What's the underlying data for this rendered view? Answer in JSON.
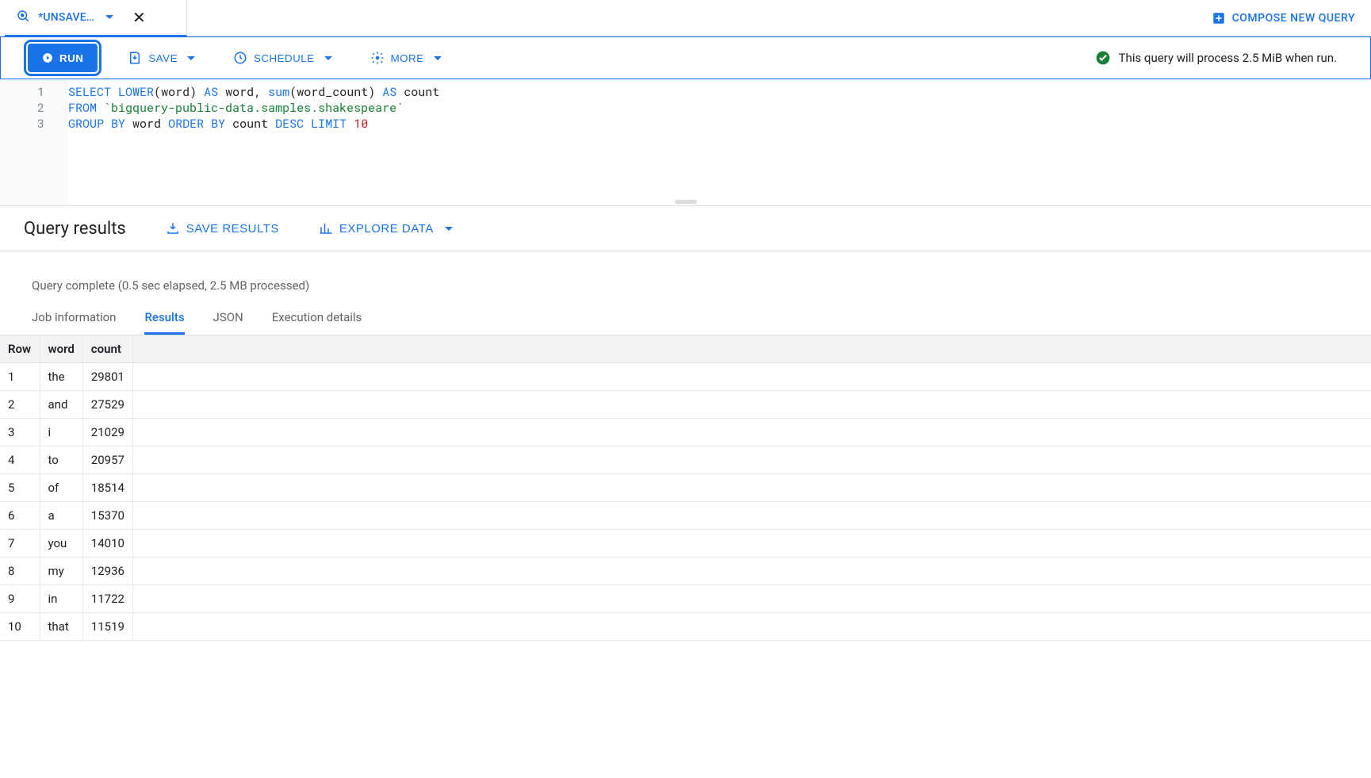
{
  "tab": {
    "title": "*UNSAVE…"
  },
  "compose": {
    "label": "COMPOSE NEW QUERY"
  },
  "toolbar": {
    "run": "RUN",
    "save": "SAVE",
    "schedule": "SCHEDULE",
    "more": "MORE",
    "status": "This query will process 2.5 MiB when run."
  },
  "editor": {
    "lines": [
      {
        "num": "1",
        "tokens": [
          {
            "t": "SELECT",
            "c": "kw"
          },
          {
            "t": " ",
            "c": "punc"
          },
          {
            "t": "LOWER",
            "c": "fn"
          },
          {
            "t": "(",
            "c": "punc"
          },
          {
            "t": "word",
            "c": "ident"
          },
          {
            "t": ")",
            "c": "punc"
          },
          {
            "t": " ",
            "c": "punc"
          },
          {
            "t": "AS",
            "c": "kw"
          },
          {
            "t": " ",
            "c": "punc"
          },
          {
            "t": "word",
            "c": "ident"
          },
          {
            "t": ", ",
            "c": "punc"
          },
          {
            "t": "sum",
            "c": "fn"
          },
          {
            "t": "(",
            "c": "punc"
          },
          {
            "t": "word_count",
            "c": "ident"
          },
          {
            "t": ")",
            "c": "punc"
          },
          {
            "t": " ",
            "c": "punc"
          },
          {
            "t": "AS",
            "c": "kw"
          },
          {
            "t": " ",
            "c": "punc"
          },
          {
            "t": "count",
            "c": "ident"
          }
        ]
      },
      {
        "num": "2",
        "tokens": [
          {
            "t": "FROM",
            "c": "kw"
          },
          {
            "t": " ",
            "c": "punc"
          },
          {
            "t": "`bigquery-public-data.samples.shakespeare`",
            "c": "str"
          }
        ]
      },
      {
        "num": "3",
        "tokens": [
          {
            "t": "GROUP BY",
            "c": "kw"
          },
          {
            "t": " ",
            "c": "punc"
          },
          {
            "t": "word",
            "c": "ident"
          },
          {
            "t": " ",
            "c": "punc"
          },
          {
            "t": "ORDER BY",
            "c": "kw"
          },
          {
            "t": " ",
            "c": "punc"
          },
          {
            "t": "count",
            "c": "ident"
          },
          {
            "t": " ",
            "c": "punc"
          },
          {
            "t": "DESC",
            "c": "kw"
          },
          {
            "t": " ",
            "c": "punc"
          },
          {
            "t": "LIMIT",
            "c": "kw"
          },
          {
            "t": " ",
            "c": "punc"
          },
          {
            "t": "10",
            "c": "num"
          }
        ]
      }
    ]
  },
  "results_header": {
    "title": "Query results",
    "save_results": "SAVE RESULTS",
    "explore_data": "EXPLORE DATA"
  },
  "query_status": "Query complete (0.5 sec elapsed, 2.5 MB processed)",
  "result_tabs": {
    "job_info": "Job information",
    "results": "Results",
    "json": "JSON",
    "exec": "Execution details"
  },
  "table": {
    "headers": {
      "row": "Row",
      "word": "word",
      "count": "count"
    },
    "rows": [
      {
        "row": "1",
        "word": "the",
        "count": "29801"
      },
      {
        "row": "2",
        "word": "and",
        "count": "27529"
      },
      {
        "row": "3",
        "word": "i",
        "count": "21029"
      },
      {
        "row": "4",
        "word": "to",
        "count": "20957"
      },
      {
        "row": "5",
        "word": "of",
        "count": "18514"
      },
      {
        "row": "6",
        "word": "a",
        "count": "15370"
      },
      {
        "row": "7",
        "word": "you",
        "count": "14010"
      },
      {
        "row": "8",
        "word": "my",
        "count": "12936"
      },
      {
        "row": "9",
        "word": "in",
        "count": "11722"
      },
      {
        "row": "10",
        "word": "that",
        "count": "11519"
      }
    ]
  }
}
